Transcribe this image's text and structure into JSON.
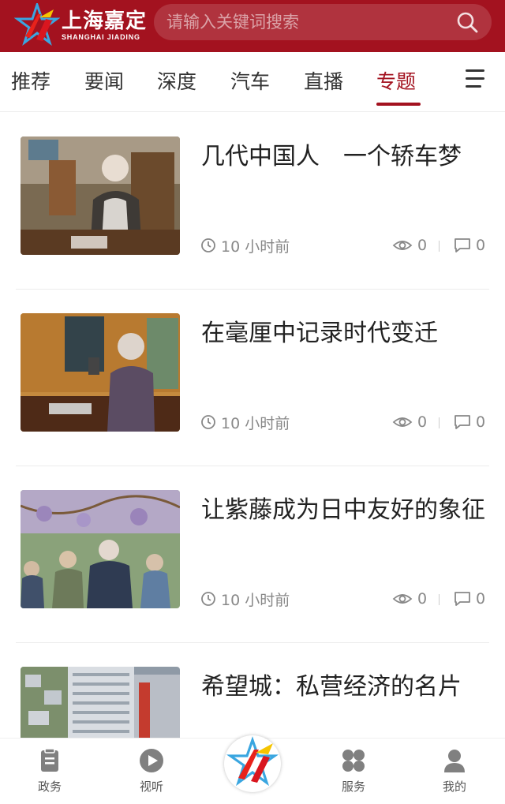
{
  "header": {
    "logo_cn": "上海嘉定",
    "logo_en": "SHANGHAI JIADING",
    "search_placeholder": "请输入关键词搜索"
  },
  "tabs": [
    {
      "label": "推荐"
    },
    {
      "label": "要闻"
    },
    {
      "label": "深度"
    },
    {
      "label": "汽车"
    },
    {
      "label": "直播"
    },
    {
      "label": "专题",
      "active": true
    }
  ],
  "articles": [
    {
      "title": "几代中国人　一个轿车梦",
      "time": "10 小时前",
      "views": "0",
      "comments": "0"
    },
    {
      "title": "在毫厘中记录时代变迁",
      "time": "10 小时前",
      "views": "0",
      "comments": "0"
    },
    {
      "title": "让紫藤成为日中友好的象征",
      "time": "10 小时前",
      "views": "0",
      "comments": "0"
    },
    {
      "title": "希望城：私营经济的名片",
      "time": "",
      "views": "",
      "comments": ""
    }
  ],
  "bottom_nav": [
    {
      "label": "政务",
      "icon": "document-icon"
    },
    {
      "label": "视听",
      "icon": "play-icon"
    },
    {
      "label": "",
      "icon": "jiading-logo"
    },
    {
      "label": "服务",
      "icon": "grid-icon"
    },
    {
      "label": "我的",
      "icon": "user-icon"
    }
  ],
  "colors": {
    "brand": "#a3121f",
    "meta": "#888888"
  }
}
